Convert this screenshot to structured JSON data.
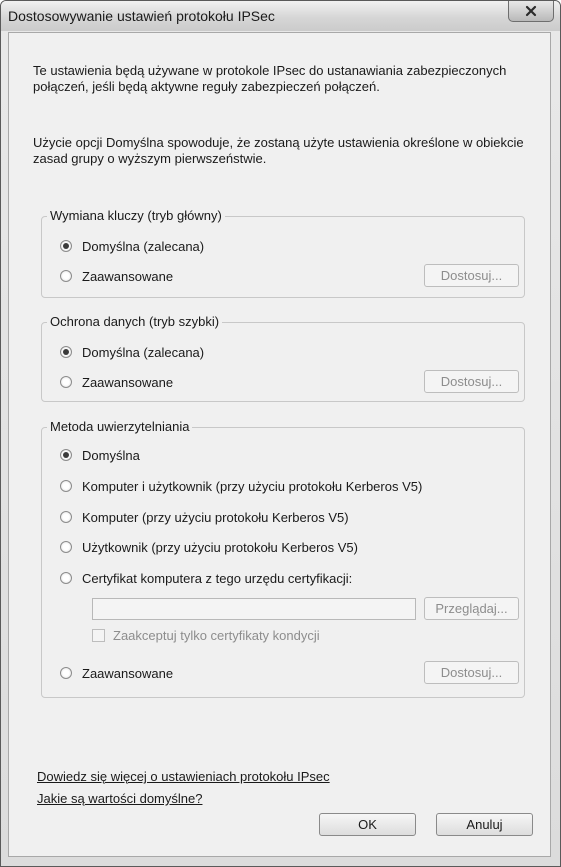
{
  "window": {
    "title": "Dostosowywanie ustawień protokołu IPSec"
  },
  "intro": {
    "paragraph1": "Te ustawienia będą używane w protokole IPsec do ustanawiania zabezpieczonych połączeń, jeśli będą aktywne reguły zabezpieczeń połączeń.",
    "paragraph2": "Użycie opcji Domyślna spowoduje, że zostaną użyte ustawienia określone w obiekcie zasad grupy o wyższym pierwszeństwie."
  },
  "key_exchange": {
    "legend": "Wymiana kluczy (tryb główny)",
    "option_default": "Domyślna (zalecana)",
    "option_advanced": "Zaawansowane",
    "customize_label": "Dostosuj...",
    "selected": "default"
  },
  "data_protection": {
    "legend": "Ochrona danych (tryb szybki)",
    "option_default": "Domyślna (zalecana)",
    "option_advanced": "Zaawansowane",
    "customize_label": "Dostosuj...",
    "selected": "default"
  },
  "auth_method": {
    "legend": "Metoda uwierzytelniania",
    "option_default": "Domyślna",
    "option_computer_user": "Komputer i użytkownik (przy użyciu protokołu Kerberos V5)",
    "option_computer": "Komputer (przy użyciu protokołu Kerberos V5)",
    "option_user": "Użytkownik (przy użyciu protokołu Kerberos V5)",
    "option_certificate": "Certyfikat komputera z tego urzędu certyfikacji:",
    "certificate_value": "",
    "browse_label": "Przeglądaj...",
    "health_cert_label": "Zaakceptuj tylko certyfikaty kondycji",
    "health_cert_checked": false,
    "option_advanced": "Zaawansowane",
    "customize_label": "Dostosuj...",
    "selected": "default"
  },
  "links": {
    "learn_more": "Dowiedz się więcej o ustawieniach protokołu IPsec",
    "defaults": "Jakie są wartości domyślne?"
  },
  "buttons": {
    "ok": "OK",
    "cancel": "Anuluj"
  }
}
